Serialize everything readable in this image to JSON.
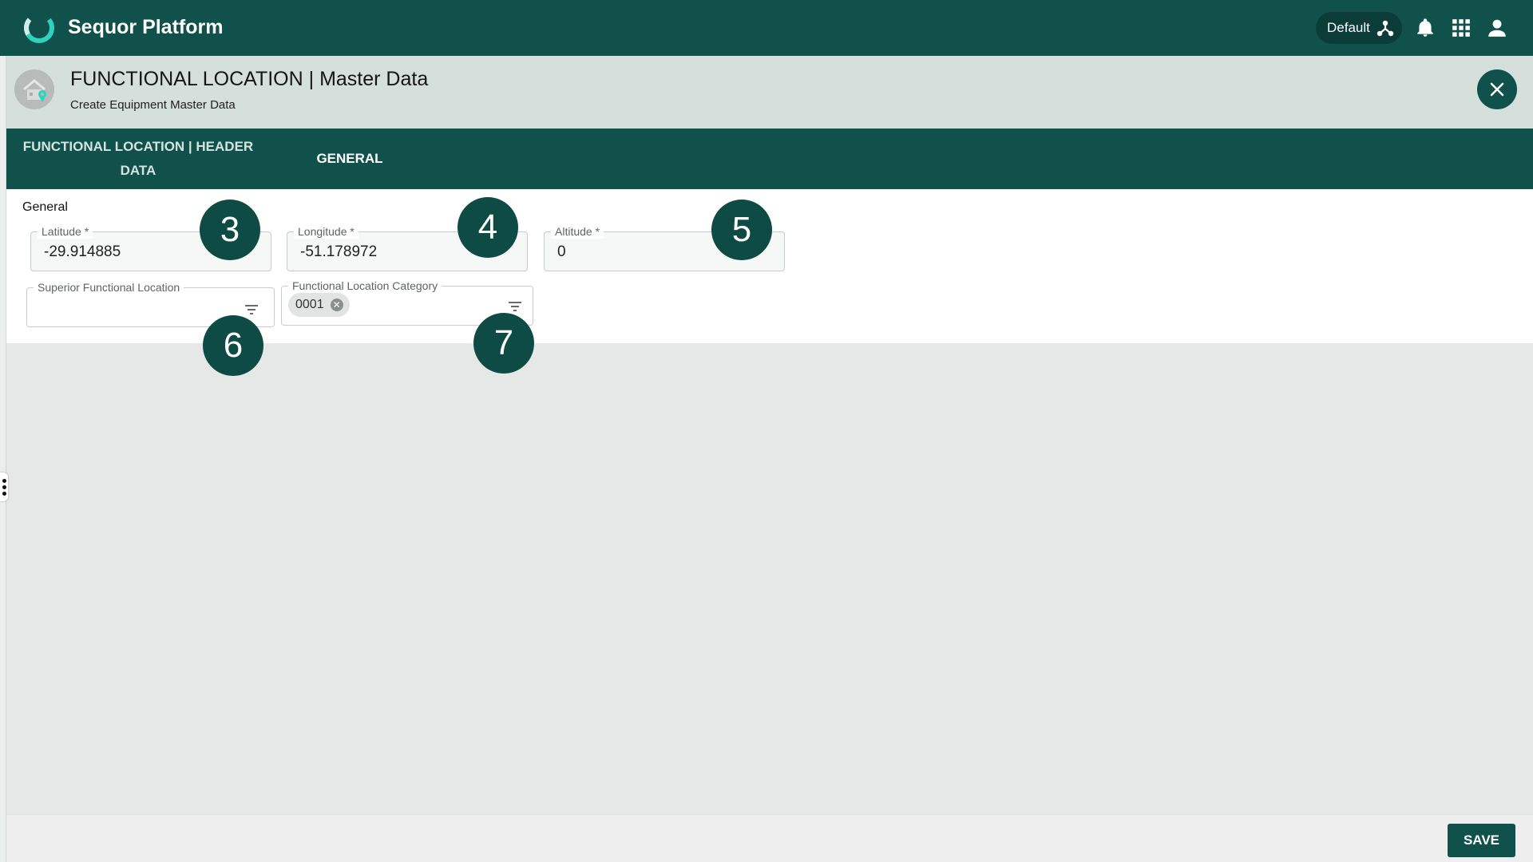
{
  "app": {
    "name": "Sequor Platform"
  },
  "topbar": {
    "environment_label": "Default"
  },
  "header": {
    "title": "FUNCTIONAL LOCATION | Master Data",
    "subtitle": "Create Equipment Master Data"
  },
  "tabs": [
    {
      "label": "FUNCTIONAL LOCATION | HEADER DATA"
    },
    {
      "label": "GENERAL"
    }
  ],
  "section": {
    "title": "General"
  },
  "fields": {
    "latitude": {
      "label": "Latitude *",
      "value": "-29.914885"
    },
    "longitude": {
      "label": "Longitude *",
      "value": "-51.178972"
    },
    "altitude": {
      "label": "Altitude *",
      "value": "0"
    },
    "superior_location": {
      "label": "Superior Functional Location",
      "value": ""
    },
    "category": {
      "label": "Functional Location Category",
      "chip": "0001"
    }
  },
  "badges": [
    "3",
    "4",
    "5",
    "6",
    "7"
  ],
  "footer": {
    "save_label": "SAVE"
  },
  "colors": {
    "primary": "#11514b",
    "header_bg": "#d5dfdc",
    "page_bg": "#e6e8e7"
  }
}
